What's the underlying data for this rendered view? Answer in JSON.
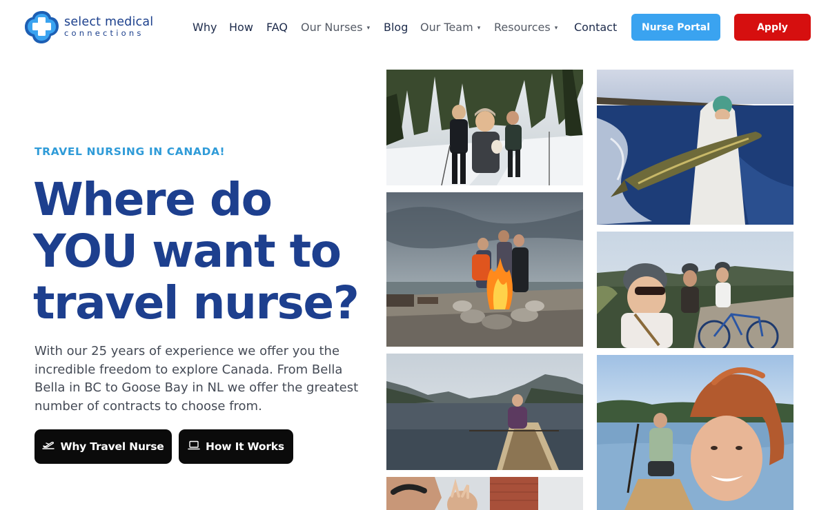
{
  "brand": {
    "name_line1": "select medical",
    "name_line2": "connections",
    "primary_color": "#1d3f8e",
    "accent_color": "#2f9bd8"
  },
  "nav": {
    "items": [
      {
        "label": "Why",
        "has_dropdown": false
      },
      {
        "label": "How",
        "has_dropdown": false
      },
      {
        "label": "FAQ",
        "has_dropdown": false
      },
      {
        "label": "Our Nurses",
        "has_dropdown": true
      },
      {
        "label": "Blog",
        "has_dropdown": false
      },
      {
        "label": "Our Team",
        "has_dropdown": true
      },
      {
        "label": "Resources",
        "has_dropdown": true
      },
      {
        "label": "Contact",
        "has_dropdown": false
      }
    ],
    "caret_glyph": "▾",
    "portal_label": "Nurse Portal",
    "portal_color": "#3aa3f0",
    "apply_label": "Apply",
    "apply_color": "#d60f0f"
  },
  "hero": {
    "eyebrow": "TRAVEL NURSING IN CANADA!",
    "headline_lines": [
      "Where do",
      "YOU want to",
      "travel nurse?"
    ],
    "description": "With our 25 years of experience we offer you the incredible freedom to explore Canada. From Bella Bella in BC to Goose Bay in NL we offer the greatest number of contracts to choose from.",
    "cta_primary": {
      "label": "Why Travel Nurse",
      "icon": "plane-icon"
    },
    "cta_secondary": {
      "label": "How It Works",
      "icon": "laptop-icon"
    }
  },
  "gallery": {
    "photos": [
      {
        "name": "photo-ski-trail",
        "icon": "image-icon"
      },
      {
        "name": "photo-beach-bonfire",
        "icon": "image-icon"
      },
      {
        "name": "photo-lake-canoe",
        "icon": "image-icon"
      },
      {
        "name": "photo-brick-building-selfie",
        "icon": "image-icon"
      },
      {
        "name": "photo-ice-fishing-pike",
        "icon": "image-icon"
      },
      {
        "name": "photo-cycling-trail",
        "icon": "image-icon"
      },
      {
        "name": "photo-river-canoe-selfie",
        "icon": "image-icon"
      }
    ]
  }
}
